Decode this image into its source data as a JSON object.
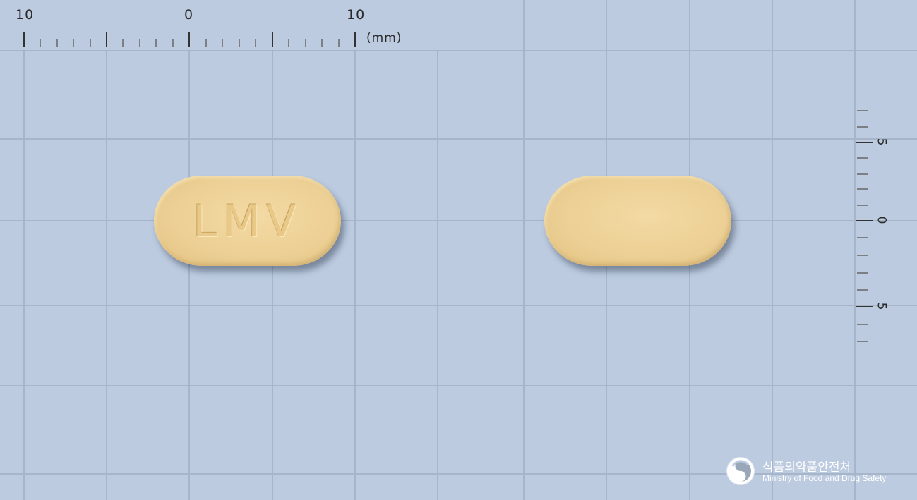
{
  "ruler_top": {
    "tick_labels": [
      "10",
      "0",
      "10"
    ],
    "unit": "(mm)"
  },
  "ruler_right": {
    "tick_labels": [
      "5",
      "0",
      "5"
    ]
  },
  "pills": [
    {
      "imprint": "LMV",
      "color": "#ecd095"
    },
    {
      "imprint": "",
      "color": "#ecd095"
    }
  ],
  "logo": {
    "name_korean": "식품의약품안전처",
    "name_english": "Ministry of Food and Drug Safety",
    "icon": "mfds-emblem-icon"
  },
  "colors": {
    "background": "#bccbe0",
    "gridline": "#a3b3c8",
    "pill": "#ecd095"
  }
}
